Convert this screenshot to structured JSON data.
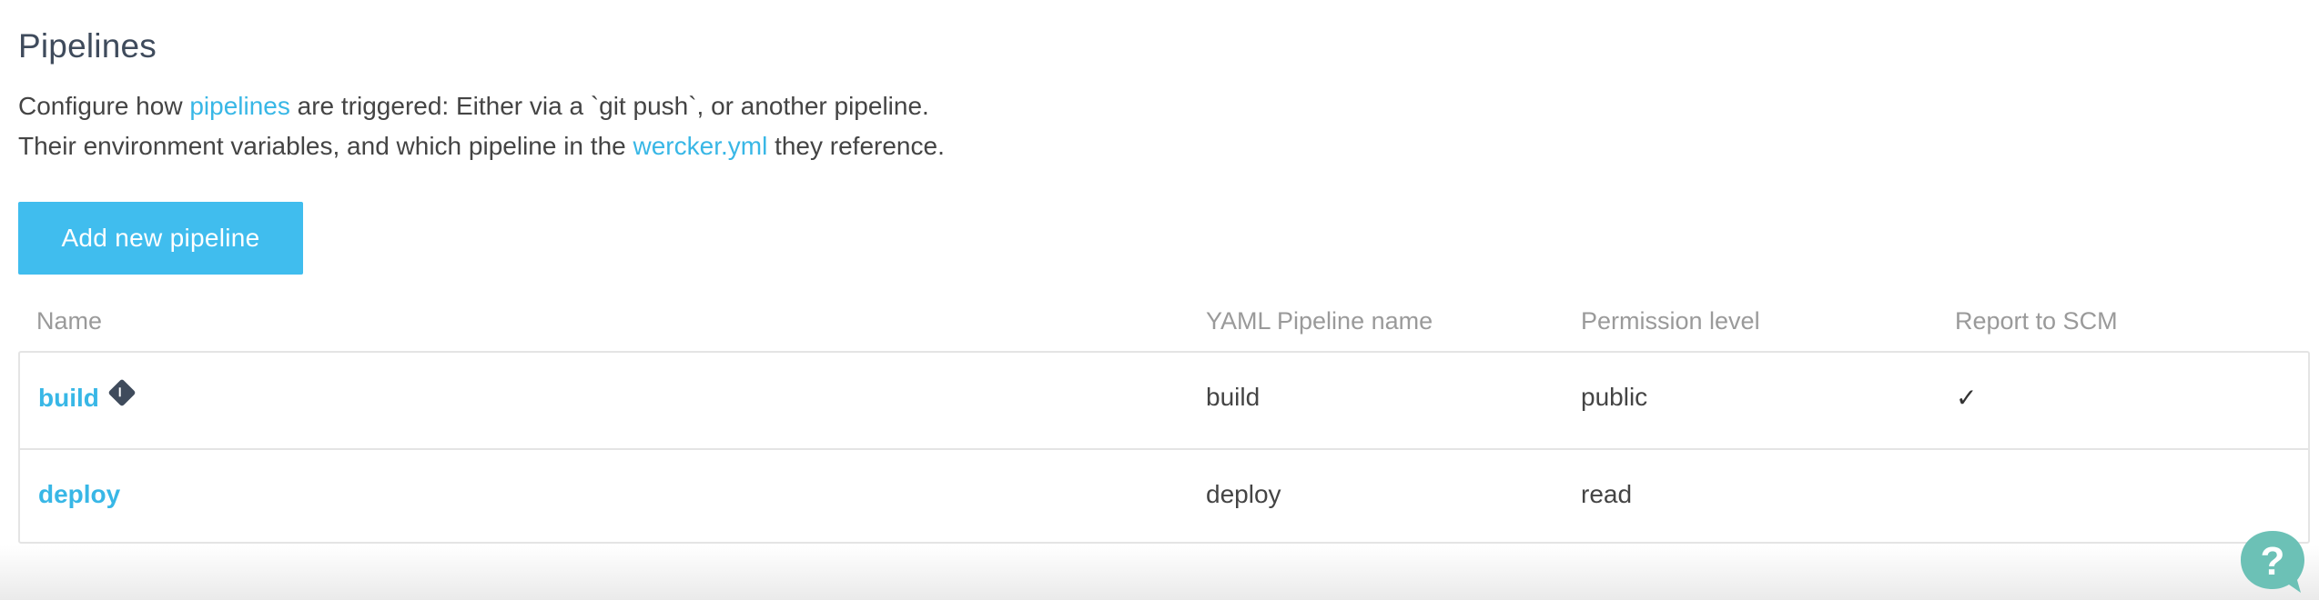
{
  "header": {
    "title": "Pipelines",
    "desc_line1_prefix": "Configure how ",
    "desc_line1_link": "pipelines",
    "desc_line1_suffix": " are triggered: Either via a `git push`, or another pipeline.",
    "desc_line2_prefix": "Their environment variables, and which pipeline in the ",
    "desc_line2_link": "wercker.yml",
    "desc_line2_suffix": " they reference."
  },
  "actions": {
    "add_label": "Add new pipeline"
  },
  "table": {
    "columns": [
      "Name",
      "YAML Pipeline name",
      "Permission level",
      "Report to SCM"
    ],
    "rows": [
      {
        "name": "build",
        "yaml_name": "build",
        "permission": "public",
        "report_scm": "✓",
        "icon": "git-icon"
      },
      {
        "name": "deploy",
        "yaml_name": "deploy",
        "permission": "read",
        "report_scm": ""
      }
    ]
  },
  "help": {
    "icon": "help-question-icon",
    "glyph": "?",
    "color": "#6cc1b6"
  },
  "colors": {
    "accent": "#40bdee",
    "link": "#38b7e6",
    "heading": "#3f4b5c"
  }
}
